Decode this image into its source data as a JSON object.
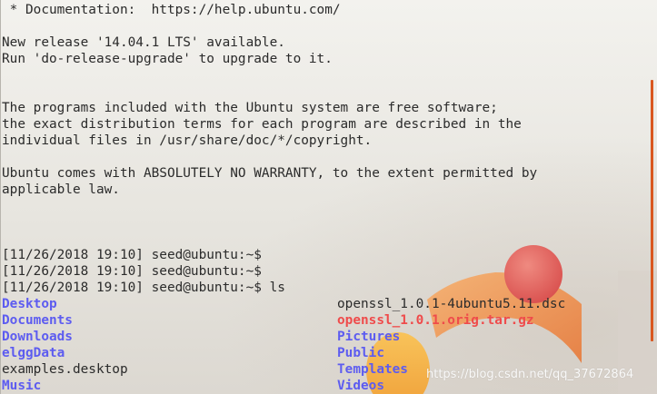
{
  "terminal": {
    "lines": [
      " * Documentation:  https://help.ubuntu.com/",
      "",
      "New release '14.04.1 LTS' available.",
      "Run 'do-release-upgrade' to upgrade to it.",
      "",
      "",
      "The programs included with the Ubuntu system are free software;",
      "the exact distribution terms for each program are described in the",
      "individual files in /usr/share/doc/*/copyright.",
      "",
      "Ubuntu comes with ABSOLUTELY NO WARRANTY, to the extent permitted by",
      "applicable law.",
      "",
      "",
      "",
      "[11/26/2018 19:10] seed@ubuntu:~$",
      "[11/26/2018 19:10] seed@ubuntu:~$",
      "[11/26/2018 19:10] seed@ubuntu:~$ ls"
    ],
    "ls_output": {
      "left_column": [
        {
          "name": "Desktop",
          "type": "directory"
        },
        {
          "name": "Documents",
          "type": "directory"
        },
        {
          "name": "Downloads",
          "type": "directory"
        },
        {
          "name": "elggData",
          "type": "directory"
        },
        {
          "name": "examples.desktop",
          "type": "file"
        },
        {
          "name": "Music",
          "type": "directory"
        }
      ],
      "right_column": [
        {
          "name": "openssl_1.0.1-4ubuntu5.11.dsc",
          "type": "file"
        },
        {
          "name": "openssl_1.0.1.orig.tar.gz",
          "type": "archive"
        },
        {
          "name": "Pictures",
          "type": "directory"
        },
        {
          "name": "Public",
          "type": "directory"
        },
        {
          "name": "Templates",
          "type": "directory"
        },
        {
          "name": "Videos",
          "type": "directory"
        }
      ]
    }
  },
  "watermark": "https://blog.csdn.net/qq_37672864",
  "colors": {
    "text": "#2b2b2b",
    "directory": "#5d5cf0",
    "archive": "#ef4b4b",
    "accent": "#d9571f",
    "logo_red": "#e06262",
    "logo_orange": "#ee9a55"
  }
}
